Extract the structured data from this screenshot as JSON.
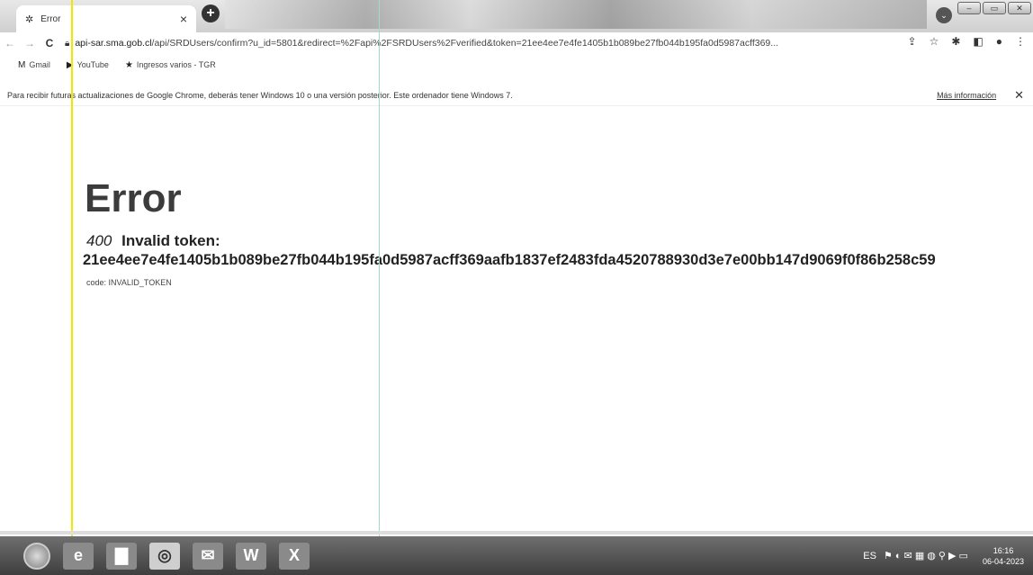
{
  "tab": {
    "title": "Error",
    "favicon": "chrome-favicon-icon"
  },
  "address": {
    "host": "api-sar.sma.gob.cl",
    "path": "/api/SRDUsers/confirm?u_id=5801&redirect=%2Fapi%2FSRDUsers%2Fverified&token=21ee4ee7e4fe1405b1b089be27fb044b195fa0d5987acff369..."
  },
  "bookmarks": [
    {
      "label": "Gmail",
      "icon": "gmail-icon"
    },
    {
      "label": "YouTube",
      "icon": "youtube-icon"
    },
    {
      "label": "Ingresos varios - TGR",
      "icon": "star-icon"
    }
  ],
  "infobar": {
    "message": "Para recibir futuras actualizaciones de Google Chrome, deberás tener Windows 10 o una versión posterior. Este ordenador tiene Windows 7.",
    "link": "Más información"
  },
  "page": {
    "heading": "Error",
    "status_code": "400",
    "message": "Invalid token:",
    "token": "21ee4ee7e4fe1405b1b089be27fb044b195fa0d5987acff369aafb1837ef2483fda4520788930d3e7e00bb147d9069f0f86b258c59",
    "code_line": "code: INVALID_TOKEN"
  },
  "taskbar": {
    "language": "ES",
    "time": "16:16",
    "date": "06-04-2023"
  }
}
